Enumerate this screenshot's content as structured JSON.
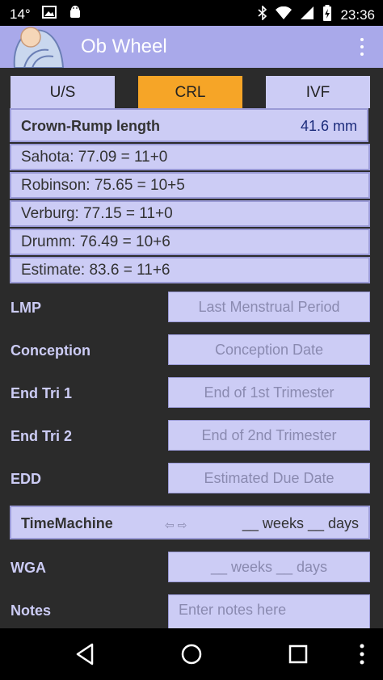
{
  "status_bar": {
    "temperature": "14°",
    "time": "23:36",
    "icons": [
      "image-icon",
      "android-icon",
      "bluetooth-icon",
      "wifi-icon",
      "signal-icon",
      "battery-charging-icon"
    ]
  },
  "app_bar": {
    "title": "Ob Wheel",
    "logo": "baby-logo-icon",
    "overflow_icon": "more-vert-icon"
  },
  "tabs": [
    {
      "label": "U/S",
      "active": false
    },
    {
      "label": "CRL",
      "active": true
    },
    {
      "label": "IVF",
      "active": false
    }
  ],
  "crl": {
    "label": "Crown-Rump length",
    "value": "41.6 mm"
  },
  "results": [
    "Sahota: 77.09 = 11+0",
    "Robinson: 75.65 = 10+5",
    "Verburg: 77.15 = 11+0",
    "Drumm: 76.49 = 10+6",
    "Estimate: 83.6 = 11+6"
  ],
  "fields": [
    {
      "label": "LMP",
      "placeholder": "Last Menstrual Period"
    },
    {
      "label": "Conception",
      "placeholder": "Conception Date"
    },
    {
      "label": "End Tri 1",
      "placeholder": "End of 1st Trimester"
    },
    {
      "label": "End Tri 2",
      "placeholder": "End of 2nd Trimester"
    },
    {
      "label": "EDD",
      "placeholder": "Estimated Due Date"
    }
  ],
  "time_machine": {
    "label": "TimeMachine",
    "arrows": "⇦ ⇨",
    "value": "__ weeks __ days"
  },
  "wga": {
    "label": "WGA",
    "placeholder": "__ weeks __ days"
  },
  "notes": {
    "label": "Notes",
    "placeholder": "Enter notes here"
  },
  "colors": {
    "background": "#2b2b2b",
    "app_bar": "#a9a9ea",
    "active_tab": "#f6a527",
    "field_fill": "#ccccf5",
    "label_text": "#ccccf5"
  },
  "nav_bar": [
    "back-icon",
    "home-icon",
    "recents-icon",
    "more-vert-icon"
  ]
}
